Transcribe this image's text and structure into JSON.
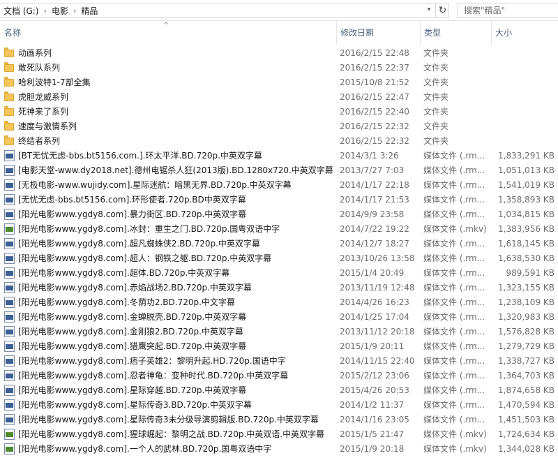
{
  "address": {
    "crumbs": [
      "文档 (G:)",
      "电影",
      "精品"
    ],
    "search_placeholder": "搜索\"精品\""
  },
  "columns": {
    "name": "名称",
    "date": "修改日期",
    "type": "类型",
    "size": "大小"
  },
  "files": [
    {
      "icon": "folder-icon",
      "name": "动画系列",
      "date": "2016/2/15 22:48",
      "type": "文件夹",
      "size": ""
    },
    {
      "icon": "folder-icon",
      "name": "敢死队系列",
      "date": "2016/2/15 22:37",
      "type": "文件夹",
      "size": ""
    },
    {
      "icon": "folder-icon",
      "name": "哈利波特1-7部全集",
      "date": "2015/10/8 21:52",
      "type": "文件夹",
      "size": ""
    },
    {
      "icon": "folder-icon",
      "name": "虎胆龙威系列",
      "date": "2016/2/15 22:47",
      "type": "文件夹",
      "size": ""
    },
    {
      "icon": "folder-icon",
      "name": "死神来了系列",
      "date": "2016/2/15 22:40",
      "type": "文件夹",
      "size": ""
    },
    {
      "icon": "folder-icon",
      "name": "速度与激情系列",
      "date": "2016/2/15 22:32",
      "type": "文件夹",
      "size": ""
    },
    {
      "icon": "folder-icon",
      "name": "终结者系列",
      "date": "2016/2/15 22:32",
      "type": "文件夹",
      "size": ""
    },
    {
      "icon": "rmvb-file-icon",
      "name": "[BT无忧无虑-bbs.bt5156.com.].环太平洋.BD.720p.中英双字幕",
      "date": "2014/3/1 3:26",
      "type": "媒体文件 (.rm...",
      "size": "1,833,291 KB"
    },
    {
      "icon": "rmvb-file-icon",
      "name": "[电影天堂-www.dy2018.net].德州电锯杀人狂(2013版).BD.1280x720.中英双字幕",
      "date": "2013/7/27 7:03",
      "type": "媒体文件 (.rm...",
      "size": "1,051,013 KB"
    },
    {
      "icon": "rmvb-file-icon",
      "name": "[无极电影-www.wujidy.com].星际迷航：暗黑无界.BD.720p.中英双字幕",
      "date": "2014/1/17 22:18",
      "type": "媒体文件 (.rm...",
      "size": "1,541,019 KB"
    },
    {
      "icon": "rmvb-file-icon",
      "name": "[无忧无虑-bbs.bt5156.com].环形使者.720p.BD中英双字幕",
      "date": "2014/1/17 21:53",
      "type": "媒体文件 (.rm...",
      "size": "1,358,893 KB"
    },
    {
      "icon": "rmvb-file-icon",
      "name": "[阳光电影www.ygdy8.com].暴力街区.BD.720p.中英双字幕",
      "date": "2014/9/9 23:58",
      "type": "媒体文件 (.rm...",
      "size": "1,034,815 KB"
    },
    {
      "icon": "mkv-file-icon",
      "name": "[阳光电影www.ygdy8.com].冰封：重生之门.BD.720p.国粤双语中字",
      "date": "2014/7/22 19:22",
      "type": "媒体文件 (.mkv)",
      "size": "1,383,956 KB"
    },
    {
      "icon": "rmvb-file-icon",
      "name": "[阳光电影www.ygdy8.com].超凡蜘蛛侠2.BD.720p.中英双字幕",
      "date": "2014/12/7 18:27",
      "type": "媒体文件 (.rm...",
      "size": "1,618,145 KB"
    },
    {
      "icon": "rmvb-file-icon",
      "name": "[阳光电影www.ygdy8.com].超人：钢铁之躯.BD.720p.中英双字幕",
      "date": "2013/10/26 13:58",
      "type": "媒体文件 (.rm...",
      "size": "1,638,530 KB"
    },
    {
      "icon": "rmvb-file-icon",
      "name": "[阳光电影www.ygdy8.com].超体.BD.720p.中英双字幕",
      "date": "2015/1/4 20:49",
      "type": "媒体文件 (.rm...",
      "size": "989,591 KB"
    },
    {
      "icon": "rmvb-file-icon",
      "name": "[阳光电影www.ygdy8.com].赤焰战场2.BD.720p.中英双字幕",
      "date": "2013/11/19 12:48",
      "type": "媒体文件 (.rm...",
      "size": "1,323,155 KB"
    },
    {
      "icon": "rmvb-file-icon",
      "name": "[阳光电影www.ygdy8.com].冬荫功2.BD.720p.中文字幕",
      "date": "2014/4/26 16:23",
      "type": "媒体文件 (.rm...",
      "size": "1,238,109 KB"
    },
    {
      "icon": "rmvb-file-icon",
      "name": "[阳光电影www.ygdy8.com].金蝉脱壳.BD.720p.中英双字幕",
      "date": "2014/1/25 17:04",
      "type": "媒体文件 (.rm...",
      "size": "1,320,983 KB"
    },
    {
      "icon": "rmvb-file-icon",
      "name": "[阳光电影www.ygdy8.com].金刚狼2.BD.720p.中英双字幕",
      "date": "2013/11/12 20:18",
      "type": "媒体文件 (.rm...",
      "size": "1,576,828 KB"
    },
    {
      "icon": "rmvb-file-icon",
      "name": "[阳光电影www.ygdy8.com].猎鹰突起.BD.720p.中英双字幕",
      "date": "2015/1/9 20:11",
      "type": "媒体文件 (.rm...",
      "size": "1,279,729 KB"
    },
    {
      "icon": "rmvb-file-icon",
      "name": "[阳光电影www.ygdy8.com].痞子英雄2：黎明升起.HD.720p.国语中字",
      "date": "2014/11/15 22:40",
      "type": "媒体文件 (.rm...",
      "size": "1,338,727 KB"
    },
    {
      "icon": "rmvb-file-icon",
      "name": "[阳光电影www.ygdy8.com].忍者神龟：变种时代.BD.720p.中英双字幕",
      "date": "2015/2/12 23:06",
      "type": "媒体文件 (.rm...",
      "size": "1,364,703 KB"
    },
    {
      "icon": "rmvb-file-icon",
      "name": "[阳光电影www.ygdy8.com].星际穿越.BD.720p.中英双字幕",
      "date": "2015/4/26 20:53",
      "type": "媒体文件 (.rm...",
      "size": "1,874,658 KB"
    },
    {
      "icon": "rmvb-file-icon",
      "name": "[阳光电影www.ygdy8.com].星际传奇3.BD.720p.中英双字幕",
      "date": "2014/1/2 11:37",
      "type": "媒体文件 (.rm...",
      "size": "1,470,594 KB"
    },
    {
      "icon": "rmvb-file-icon",
      "name": "[阳光电影www.ygdy8.com].星际传奇3未分级导演剪辑版.BD.720p.中英双字幕",
      "date": "2014/1/16 23:05",
      "type": "媒体文件 (.rm...",
      "size": "1,451,503 KB"
    },
    {
      "icon": "mkv-file-icon",
      "name": "[阳光电影www.ygdy8.com].猩球崛起：黎明之战.BD.720p.中英双语.中英双字幕",
      "date": "2015/1/5 21:47",
      "type": "媒体文件 (.mkv)",
      "size": "1,724,634 KB"
    },
    {
      "icon": "mkv-file-icon",
      "name": "[阳光电影www.ygdy8.com].一个人的武林.BD.720p.国粤双语中字",
      "date": "2015/1/9 20:18",
      "type": "媒体文件 (.mkv)",
      "size": "1,344,028 KB"
    }
  ]
}
